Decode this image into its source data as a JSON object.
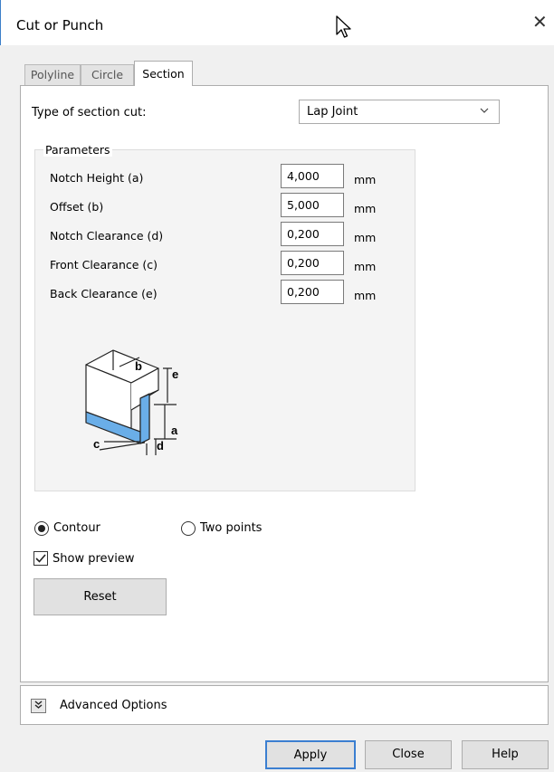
{
  "window": {
    "title": "Cut or Punch",
    "close_glyph": "✕"
  },
  "tabs": [
    {
      "label": "Polyline",
      "active": false
    },
    {
      "label": "Circle",
      "active": false
    },
    {
      "label": "Section",
      "active": true
    }
  ],
  "section": {
    "type_label": "Type of section cut:",
    "type_value": "Lap Joint",
    "parameters_title": "Parameters",
    "params": [
      {
        "label": "Notch Height (a)",
        "value": "4,000",
        "unit": "mm"
      },
      {
        "label": "Offset (b)",
        "value": "5,000",
        "unit": "mm"
      },
      {
        "label": "Notch Clearance (d)",
        "value": "0,200",
        "unit": "mm"
      },
      {
        "label": "Front Clearance (c)",
        "value": "0,200",
        "unit": "mm"
      },
      {
        "label": "Back Clearance (e)",
        "value": "0,200",
        "unit": "mm"
      }
    ],
    "diagram_labels": {
      "a": "a",
      "b": "b",
      "c": "c",
      "d": "d",
      "e": "e"
    },
    "accent_color": "#6aaee8"
  },
  "options": {
    "contour_label": "Contour",
    "two_points_label": "Two points",
    "selected": "contour",
    "show_preview_label": "Show preview",
    "show_preview_checked": true,
    "reset_label": "Reset"
  },
  "advanced": {
    "label": "Advanced Options",
    "toggle_glyph": "¥"
  },
  "footer": {
    "apply_label": "Apply",
    "close_label": "Close",
    "help_label": "Help"
  },
  "colors": {
    "focus_border": "#3b7fd1",
    "window_border": "#3c7fc9"
  }
}
